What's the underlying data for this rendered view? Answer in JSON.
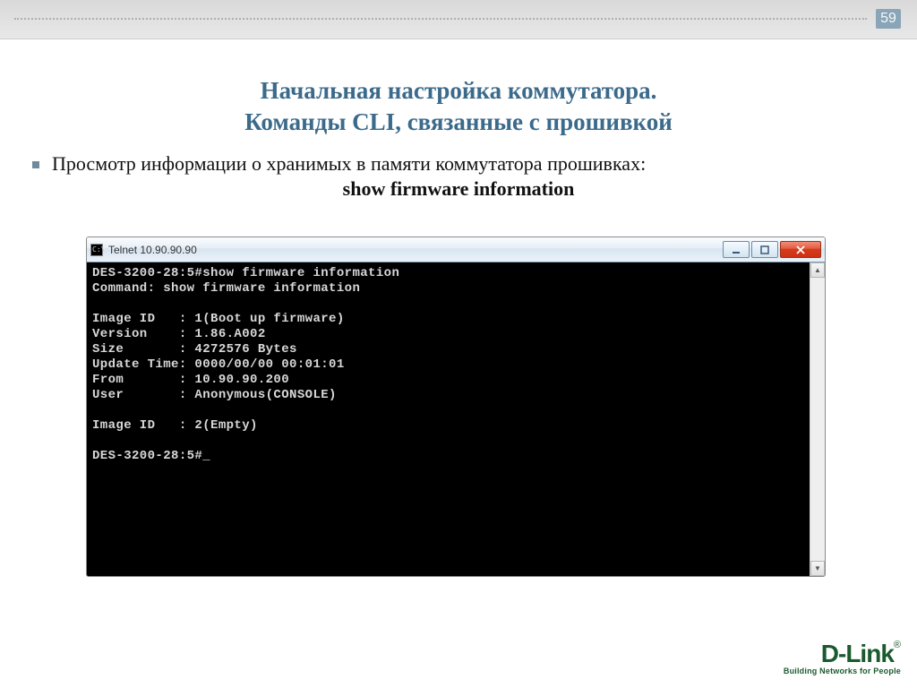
{
  "page_number": "59",
  "title": {
    "line1": "Начальная настройка коммутатора.",
    "line2": "Команды CLI, связанные с прошивкой"
  },
  "bullet": {
    "text": "Просмотр информации о хранимых в памяти коммутатора прошивках:",
    "command": "show firmware information"
  },
  "window": {
    "title": "Telnet 10.90.90.90",
    "icon_label": "C:\\"
  },
  "terminal": {
    "line1": "DES-3200-28:5#show firmware information",
    "line2": "Command: show firmware information",
    "blank1": "",
    "line3": "Image ID   : 1(Boot up firmware)",
    "line4": "Version    : 1.86.A002",
    "line5": "Size       : 4272576 Bytes",
    "line6": "Update Time: 0000/00/00 00:01:01",
    "line7": "From       : 10.90.90.200",
    "line8": "User       : Anonymous(CONSOLE)",
    "blank2": "",
    "line9": "Image ID   : 2(Empty)",
    "blank3": "",
    "prompt": "DES-3200-28:5#"
  },
  "logo": {
    "brand": "D-Link",
    "reg": "®",
    "tagline": "Building Networks for People"
  }
}
